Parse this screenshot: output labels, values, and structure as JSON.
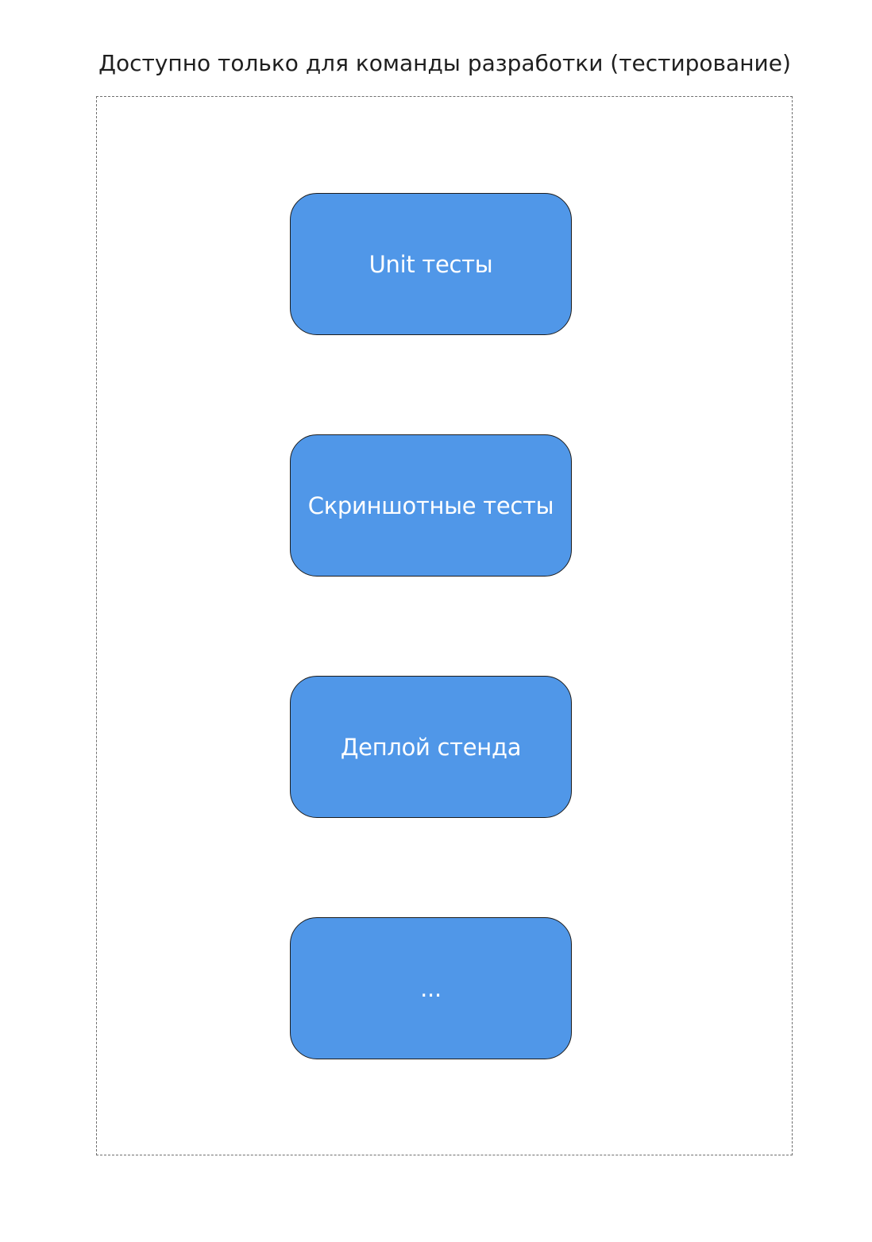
{
  "group": {
    "title": "Доступно только для команды разработки (тестирование)"
  },
  "steps": [
    {
      "label": "Unit тесты"
    },
    {
      "label": "Скриншотные тесты"
    },
    {
      "label": "Деплой стенда"
    },
    {
      "label": "..."
    }
  ],
  "colors": {
    "box_fill": "#5097e8",
    "box_border": "#1c1c1c",
    "box_text": "#ffffff",
    "frame_border": "#6f6f6f",
    "title_text": "#1f1f1f"
  }
}
